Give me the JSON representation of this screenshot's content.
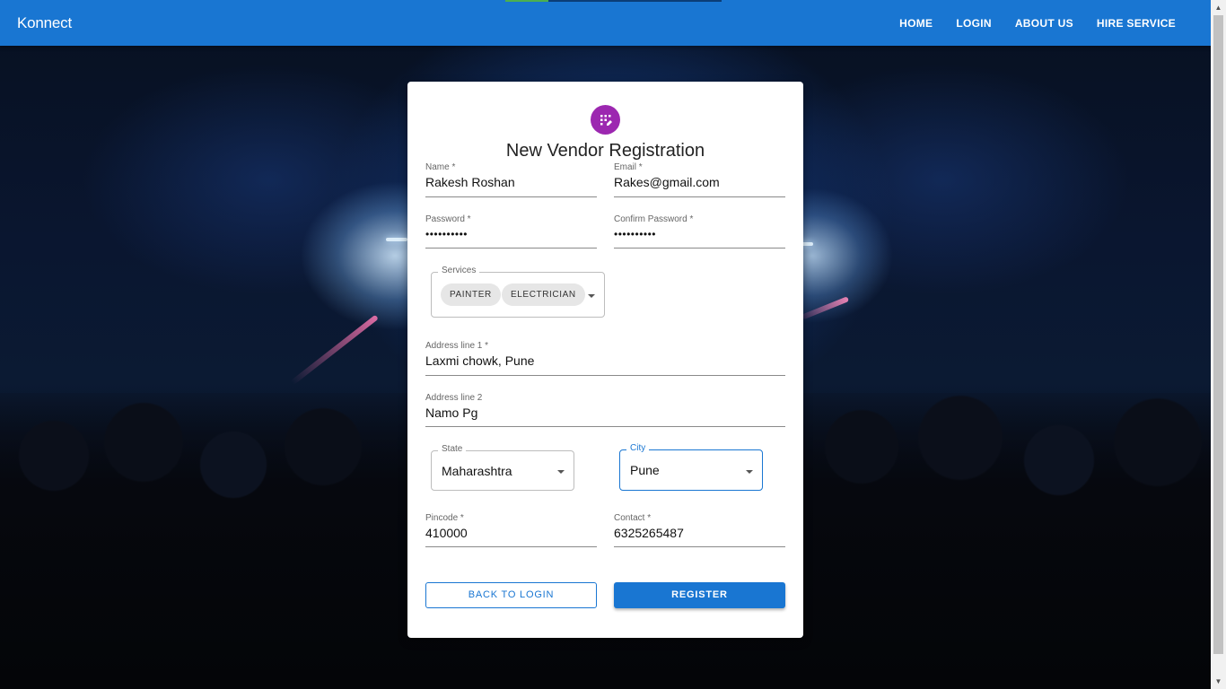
{
  "navbar": {
    "brand": "Konnect",
    "links": [
      "HOME",
      "LOGIN",
      "ABOUT US",
      "HIRE SERVICE"
    ],
    "loading_progress": 0.2
  },
  "form": {
    "title": "New Vendor Registration",
    "name": {
      "label": "Name *",
      "value": "Rakesh Roshan"
    },
    "email": {
      "label": "Email *",
      "value": "Rakes@gmail.com"
    },
    "password": {
      "label": "Password *",
      "value": "••••••••••"
    },
    "confirm_password": {
      "label": "Confirm Password *",
      "value": "••••••••••"
    },
    "services": {
      "label": "Services",
      "chips": [
        "PAINTER",
        "ELECTRICIAN"
      ]
    },
    "address1": {
      "label": "Address line 1 *",
      "value": "Laxmi chowk, Pune"
    },
    "address2": {
      "label": "Address line 2",
      "value": "Namo Pg"
    },
    "state": {
      "label": "State",
      "value": "Maharashtra"
    },
    "city": {
      "label": "City",
      "value": "Pune"
    },
    "pincode": {
      "label": "Pincode *",
      "value": "410000"
    },
    "contact": {
      "label": "Contact *",
      "value": "6325265487"
    },
    "back_button": "BACK TO LOGIN",
    "register_button": "REGISTER"
  },
  "colors": {
    "primary": "#1976d2",
    "avatar": "#9c27b0",
    "progress": "#4caf50"
  }
}
